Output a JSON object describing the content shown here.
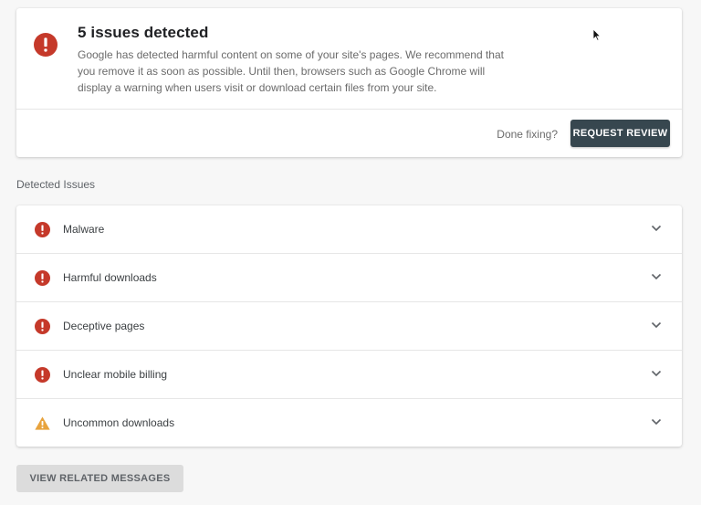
{
  "summary": {
    "title": "5 issues detected",
    "body": "Google has detected harmful content on some of your site's pages. We recommend that you remove it as soon as possible. Until then, browsers such as Google Chrome will display a warning when users visit or download certain files from your site.",
    "done_fixing_label": "Done fixing?",
    "request_review_label": "REQUEST REVIEW",
    "icon": "error-icon"
  },
  "section_heading": "Detected Issues",
  "issues": [
    {
      "label": "Malware",
      "icon": "error-icon"
    },
    {
      "label": "Harmful downloads",
      "icon": "error-icon"
    },
    {
      "label": "Deceptive pages",
      "icon": "error-icon"
    },
    {
      "label": "Unclear mobile billing",
      "icon": "error-icon"
    },
    {
      "label": "Uncommon downloads",
      "icon": "warning-icon"
    }
  ],
  "view_related_label": "VIEW RELATED MESSAGES",
  "colors": {
    "error": "#c5392a",
    "warning": "#e8a33d",
    "primary_button": "#37474f",
    "secondary_button": "#dcdcdc",
    "background": "#f7f7f7"
  }
}
